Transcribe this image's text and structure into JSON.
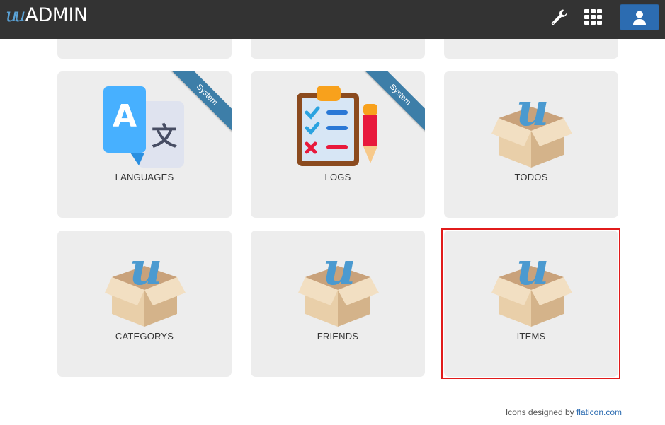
{
  "header": {
    "brand_u": "u",
    "brand_admin": "ADMIN",
    "tool_icon": "wrench-icon",
    "apps_icon": "grid-icon",
    "user_icon": "user-icon",
    "colors": {
      "bar": "#333333",
      "user_button": "#2c6cb1"
    }
  },
  "modules": [
    {
      "label": "LANGUAGES",
      "icon": "translate-icon",
      "ribbon": "System"
    },
    {
      "label": "LOGS",
      "icon": "clipboard-checklist-icon",
      "ribbon": "System"
    },
    {
      "label": "TODOS",
      "icon": "box-icon"
    },
    {
      "label": "CATEGORYS",
      "icon": "box-icon"
    },
    {
      "label": "FRIENDS",
      "icon": "box-icon"
    },
    {
      "label": "ITEMS",
      "icon": "box-icon",
      "selected": true
    }
  ],
  "footer": {
    "prefix": "Icons designed by ",
    "link": "flaticon.com"
  },
  "colors": {
    "card_bg": "#ededed",
    "ribbon": "#3d7ea8",
    "selection": "#e11b1b"
  }
}
